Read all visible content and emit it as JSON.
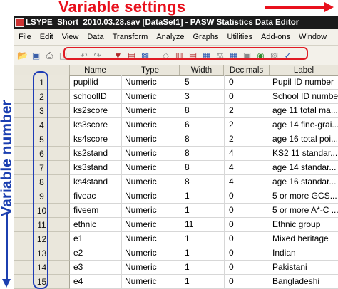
{
  "annotations": {
    "top_label": "Variable settings",
    "left_label": "Variable number"
  },
  "window": {
    "title": "LSYPE_Short_2010.03.28.sav [DataSet1] - PASW Statistics Data Editor"
  },
  "menu": {
    "items": [
      "File",
      "Edit",
      "View",
      "Data",
      "Transform",
      "Analyze",
      "Graphs",
      "Utilities",
      "Add-ons",
      "Window"
    ]
  },
  "table": {
    "columns": [
      "Name",
      "Type",
      "Width",
      "Decimals",
      "Label"
    ],
    "rows": [
      {
        "num": "1",
        "name": "pupilid",
        "type": "Numeric",
        "width": "5",
        "decimals": "0",
        "label": "Pupil ID number"
      },
      {
        "num": "2",
        "name": "schoolID",
        "type": "Numeric",
        "width": "3",
        "decimals": "0",
        "label": "School ID number"
      },
      {
        "num": "3",
        "name": "ks2score",
        "type": "Numeric",
        "width": "8",
        "decimals": "2",
        "label": "age 11 total ma..."
      },
      {
        "num": "4",
        "name": "ks3score",
        "type": "Numeric",
        "width": "6",
        "decimals": "2",
        "label": "age 14 fine-grai..."
      },
      {
        "num": "5",
        "name": "ks4score",
        "type": "Numeric",
        "width": "8",
        "decimals": "2",
        "label": "age 16 total poi..."
      },
      {
        "num": "6",
        "name": "ks2stand",
        "type": "Numeric",
        "width": "8",
        "decimals": "4",
        "label": "KS2 11 standar..."
      },
      {
        "num": "7",
        "name": "ks3stand",
        "type": "Numeric",
        "width": "8",
        "decimals": "4",
        "label": "age 14 standar..."
      },
      {
        "num": "8",
        "name": "ks4stand",
        "type": "Numeric",
        "width": "8",
        "decimals": "4",
        "label": "age 16 standar..."
      },
      {
        "num": "9",
        "name": "fiveac",
        "type": "Numeric",
        "width": "1",
        "decimals": "0",
        "label": "5 or more GCS..."
      },
      {
        "num": "10",
        "name": "fiveem",
        "type": "Numeric",
        "width": "1",
        "decimals": "0",
        "label": "5 or more A*-C ..."
      },
      {
        "num": "11",
        "name": "ethnic",
        "type": "Numeric",
        "width": "11",
        "decimals": "0",
        "label": "Ethnic group"
      },
      {
        "num": "12",
        "name": "e1",
        "type": "Numeric",
        "width": "1",
        "decimals": "0",
        "label": "Mixed heritage"
      },
      {
        "num": "13",
        "name": "e2",
        "type": "Numeric",
        "width": "1",
        "decimals": "0",
        "label": "Indian"
      },
      {
        "num": "14",
        "name": "e3",
        "type": "Numeric",
        "width": "1",
        "decimals": "0",
        "label": "Pakistani"
      },
      {
        "num": "15",
        "name": "e4",
        "type": "Numeric",
        "width": "1",
        "decimals": "0",
        "label": "Bangladeshi"
      }
    ]
  },
  "colors": {
    "annotation_red": "#e8101c",
    "annotation_blue": "#1b3fb0",
    "titlebar": "#1b1b1b"
  },
  "toolbar_icons": [
    "open-folder-icon",
    "save-disk-icon",
    "print-icon",
    "dialog-recall-icon",
    "undo-icon",
    "redo-icon",
    "goto-case-icon",
    "goto-variable-icon",
    "variables-icon",
    "find-icon",
    "insert-cases-icon",
    "insert-variable-icon",
    "split-file-icon",
    "weight-cases-icon",
    "select-cases-icon",
    "value-labels-icon",
    "use-sets-icon",
    "show-all-variables-icon",
    "spell-check-icon"
  ]
}
